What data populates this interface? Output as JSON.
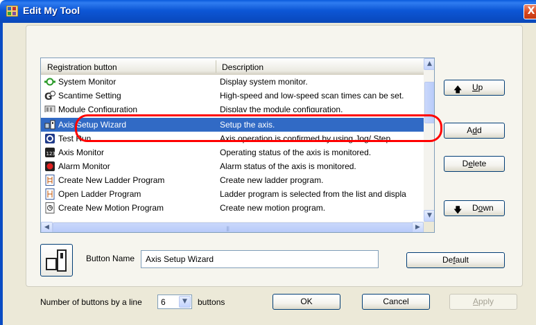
{
  "window": {
    "title": "Edit My Tool",
    "close_glyph": "X"
  },
  "list": {
    "columns": [
      "Registration button",
      "Description"
    ],
    "rows": [
      {
        "name": "System Monitor",
        "description": "Display system monitor.",
        "icon": "system-monitor-icon"
      },
      {
        "name": "Scantime Setting",
        "description": "High-speed and low-speed scan times can be set.",
        "icon": "scantime-icon"
      },
      {
        "name": "Module Configuration",
        "description": "Display the module configuration.",
        "icon": "module-config-icon"
      },
      {
        "name": "Axis Setup Wizard",
        "description": "Setup the axis.",
        "icon": "axis-setup-icon",
        "selected": true
      },
      {
        "name": "Test Run",
        "description": "Axis operation is confirmed by using Jog/ Step.",
        "icon": "test-run-icon"
      },
      {
        "name": "Axis Monitor",
        "description": "Operating status of the axis is monitored.",
        "icon": "axis-monitor-icon"
      },
      {
        "name": "Alarm Monitor",
        "description": "Alarm status of the axis is monitored.",
        "icon": "alarm-monitor-icon"
      },
      {
        "name": "Create New Ladder Program",
        "description": "Create new ladder program.",
        "icon": "new-ladder-icon"
      },
      {
        "name": "Open Ladder Program",
        "description": "Ladder program is selected from the list and displa",
        "icon": "open-ladder-icon"
      },
      {
        "name": "Create New Motion Program",
        "description": "Create new motion program.",
        "icon": "new-motion-icon"
      }
    ]
  },
  "buttons": {
    "up": {
      "label": "Up",
      "mnemonic": "U"
    },
    "add": {
      "label": "Add",
      "mnemonic": "d"
    },
    "delete": {
      "label": "Delete",
      "mnemonic": "e"
    },
    "down": {
      "label": "Down",
      "mnemonic": "o"
    },
    "default": {
      "label": "Default",
      "mnemonic": "f"
    },
    "ok": "OK",
    "cancel": "Cancel",
    "apply": {
      "label": "Apply",
      "mnemonic": "A",
      "disabled": true
    }
  },
  "button_name": {
    "label": "Button Name",
    "value": "Axis Setup Wizard"
  },
  "buttons_per_line": {
    "prefix": "Number of buttons by a line",
    "value": "6",
    "suffix": "buttons"
  },
  "colors": {
    "titlebar": "#0a4cc4",
    "selection": "#316ac5",
    "highlight": "#ff0000"
  }
}
